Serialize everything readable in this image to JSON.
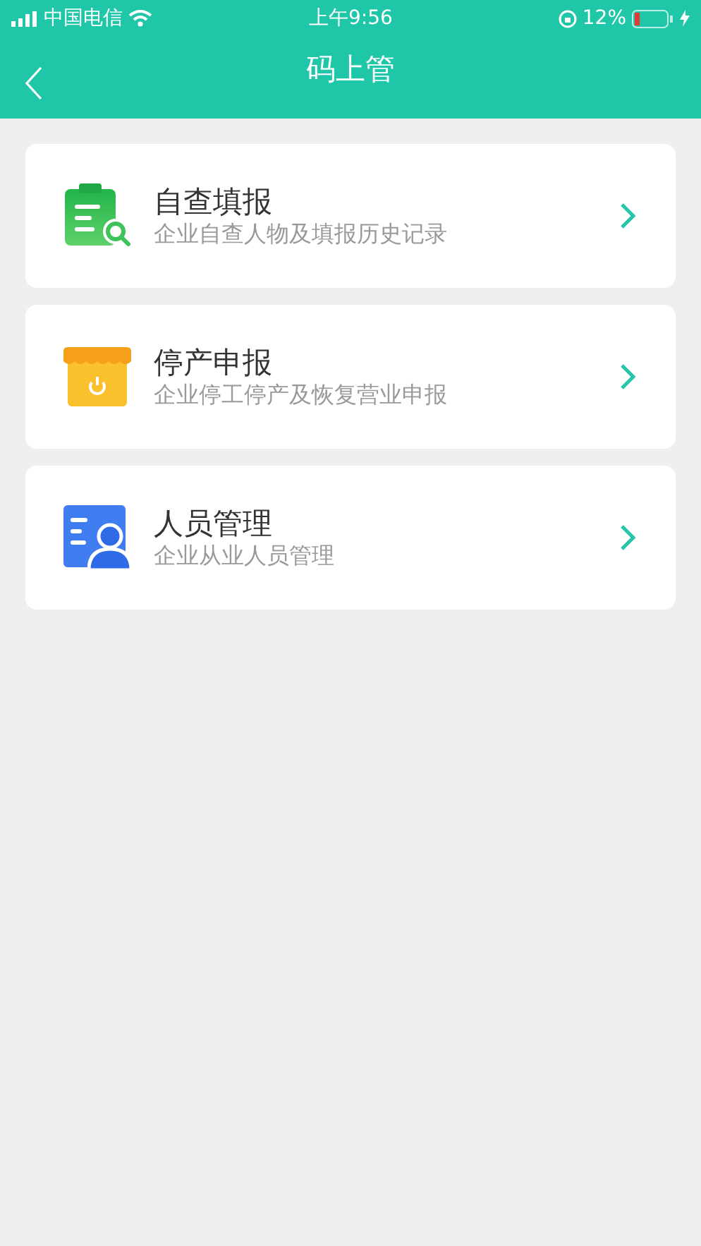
{
  "status_bar": {
    "carrier": "中国电信",
    "time": "上午9:56",
    "battery": "12%"
  },
  "nav": {
    "title": "码上管"
  },
  "items": [
    {
      "kind": "clipboard",
      "title": "自查填报",
      "subtitle": "企业自查人物及填报历史记录"
    },
    {
      "kind": "store",
      "title": "停产申报",
      "subtitle": "企业停工停产及恢复营业申报"
    },
    {
      "kind": "person",
      "title": "人员管理",
      "subtitle": "企业从业人员管理"
    }
  ]
}
